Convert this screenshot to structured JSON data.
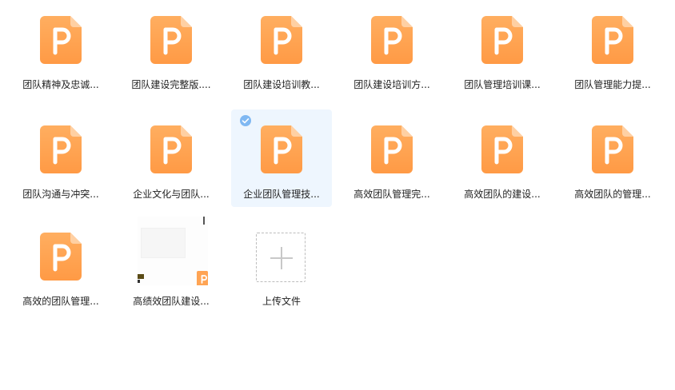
{
  "colors": {
    "ppt_icon_top": "#ffae60",
    "ppt_icon_bottom": "#ff9a45",
    "selected_bg": "#eef6fe",
    "check": "#7fb8f2"
  },
  "files": [
    {
      "name": "团队精神及忠诚...",
      "icon": "ppt-file-icon"
    },
    {
      "name": "团队建设完整版....",
      "icon": "ppt-file-icon"
    },
    {
      "name": "团队建设培训教...",
      "icon": "ppt-file-icon"
    },
    {
      "name": "团队建设培训方...",
      "icon": "ppt-file-icon"
    },
    {
      "name": "团队管理培训课...",
      "icon": "ppt-file-icon"
    },
    {
      "name": "团队管理能力提...",
      "icon": "ppt-file-icon"
    },
    {
      "name": "团队沟通与冲突...",
      "icon": "ppt-file-icon"
    },
    {
      "name": "企业文化与团队...",
      "icon": "ppt-file-icon"
    },
    {
      "name": "企业团队管理技...",
      "icon": "ppt-file-icon",
      "selected": true
    },
    {
      "name": "高效团队管理完...",
      "icon": "ppt-file-icon"
    },
    {
      "name": "高效团队的建设...",
      "icon": "ppt-file-icon"
    },
    {
      "name": "高效团队的管理...",
      "icon": "ppt-file-icon"
    },
    {
      "name": "高效的团队管理...",
      "icon": "ppt-file-icon"
    },
    {
      "name": "高绩效团队建设...",
      "icon": "thumbnail-preview"
    }
  ],
  "upload": {
    "label": "上传文件",
    "icon": "plus-icon"
  }
}
